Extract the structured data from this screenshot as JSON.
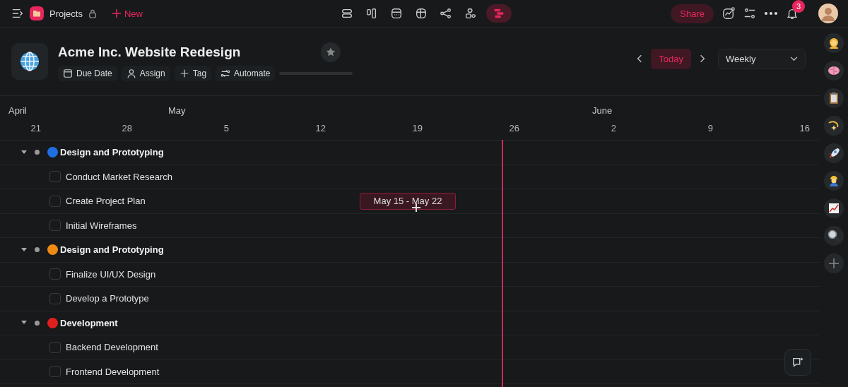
{
  "topbar": {
    "breadcrumb": "Projects",
    "new_label": "New",
    "views": [
      {
        "kind": "list",
        "selected": false
      },
      {
        "kind": "board",
        "selected": false
      },
      {
        "kind": "calendar",
        "selected": false
      },
      {
        "kind": "table",
        "selected": false
      },
      {
        "kind": "graph",
        "selected": false
      },
      {
        "kind": "hierarchy",
        "selected": false
      },
      {
        "kind": "timeline",
        "selected": true
      }
    ],
    "share": "Share",
    "notifications": "3"
  },
  "project": {
    "title": "Acme Inc. Website Redesign",
    "actions": [
      {
        "kind": "date",
        "label": "Due Date"
      },
      {
        "kind": "person",
        "label": "Assign"
      },
      {
        "kind": "plus",
        "label": "Tag"
      },
      {
        "kind": "automate",
        "label": "Automate"
      }
    ],
    "today": "Today",
    "scale": "Weekly"
  },
  "timeline": {
    "months": [
      "April",
      "May",
      "June"
    ],
    "days": [
      "21",
      "28",
      "5",
      "12",
      "19",
      "26",
      "2",
      "9",
      "16"
    ],
    "groups": [
      {
        "title": "Design and Prototyping",
        "color": "#1f6fe0",
        "expanded": true,
        "tasks": [
          {
            "name": "Conduct Market Research",
            "checked": false
          },
          {
            "name": "Create Project Plan",
            "checked": false,
            "bar": "May 15 - May 22"
          },
          {
            "name": "Initial Wireframes",
            "checked": false
          }
        ]
      },
      {
        "title": "Design and Prototyping",
        "color": "#f08a12",
        "expanded": true,
        "tasks": [
          {
            "name": "Finalize UI/UX Design",
            "checked": false
          },
          {
            "name": "Develop a Prototype",
            "checked": false
          }
        ]
      },
      {
        "title": "Development",
        "color": "#e0201c",
        "expanded": true,
        "tasks": [
          {
            "name": "Backend Development",
            "checked": false
          },
          {
            "name": "Frontend Development",
            "checked": false
          }
        ]
      }
    ]
  },
  "rail": [
    {
      "kind": "person"
    },
    {
      "kind": "brain"
    },
    {
      "kind": "clipboard"
    },
    {
      "kind": "comet"
    },
    {
      "kind": "rocket"
    },
    {
      "kind": "worker"
    },
    {
      "kind": "chart"
    },
    {
      "kind": "magnifier"
    },
    {
      "kind": "add"
    }
  ]
}
